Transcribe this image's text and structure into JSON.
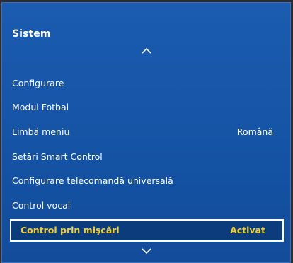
{
  "panel": {
    "title": "Sistem"
  },
  "menu": {
    "items": [
      {
        "label": "Configurare",
        "value": ""
      },
      {
        "label": "Modul Fotbal",
        "value": ""
      },
      {
        "label": "Limbă meniu",
        "value": "Română"
      },
      {
        "label": "Setări Smart Control",
        "value": ""
      },
      {
        "label": "Configurare telecomandă universală",
        "value": ""
      },
      {
        "label": "Control vocal",
        "value": ""
      },
      {
        "label": "Control prin mişcări",
        "value": "Activat"
      }
    ],
    "selected_index": 6
  },
  "icons": {
    "scroll_up": "chevron-up-icon",
    "scroll_down": "chevron-down-icon"
  },
  "colors": {
    "panel_blue": "#1553a5",
    "selected_text": "#f2cf2f",
    "text": "#ffffff"
  }
}
